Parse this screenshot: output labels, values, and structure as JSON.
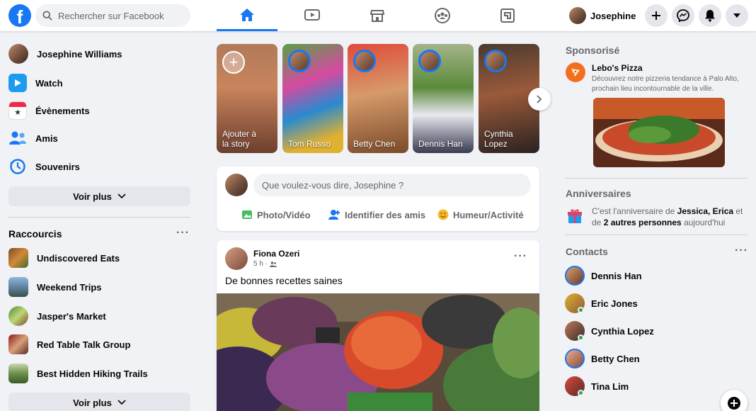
{
  "topbar": {
    "search_placeholder": "Rechercher sur Facebook",
    "profile_name": "Josephine"
  },
  "left": {
    "profile": "Josephine Williams",
    "items": [
      {
        "label": "Watch",
        "icon": "watch-icon"
      },
      {
        "label": "Évènements",
        "icon": "events-icon"
      },
      {
        "label": "Amis",
        "icon": "friends-icon"
      },
      {
        "label": "Souvenirs",
        "icon": "memories-icon"
      }
    ],
    "see_more": "Voir plus",
    "shortcuts_title": "Raccourcis",
    "shortcuts": [
      "Undiscovered Eats",
      "Weekend Trips",
      "Jasper's Market",
      "Red Table Talk Group",
      "Best Hidden Hiking Trails"
    ],
    "see_more_2": "Voir plus"
  },
  "stories": [
    {
      "name": "Ajouter à\nla story"
    },
    {
      "name": "Tom Russo"
    },
    {
      "name": "Betty Chen"
    },
    {
      "name": "Dennis Han"
    },
    {
      "name": "Cynthia\nLopez"
    }
  ],
  "composer": {
    "placeholder": "Que voulez-vous dire, Josephine ?",
    "photo": "Photo/Vidéo",
    "tag": "Identifier des amis",
    "mood": "Humeur/Activité"
  },
  "post": {
    "author": "Fiona Ozeri",
    "time": "5 h ·",
    "text": "De bonnes recettes saines"
  },
  "right": {
    "sponsored_title": "Sponsorisé",
    "ad_name": "Lebo's Pizza",
    "ad_text": "Découvrez notre pizzeria tendance à Palo Alto, prochain lieu incontournable de la ville.",
    "birthdays_title": "Anniversaires",
    "birthday_pre": "C'est l'anniversaire de ",
    "birthday_names": "Jessica, Erica",
    "birthday_mid": " et de ",
    "birthday_others": "2 autres personnes",
    "birthday_post": " aujourd'hui",
    "contacts_title": "Contacts",
    "contacts": [
      "Dennis Han",
      "Eric Jones",
      "Cynthia Lopez",
      "Betty Chen",
      "Tina Lim"
    ]
  },
  "colors": {
    "accent": "#1877f2",
    "bg": "#f0f2f5",
    "online": "#31a24c"
  }
}
